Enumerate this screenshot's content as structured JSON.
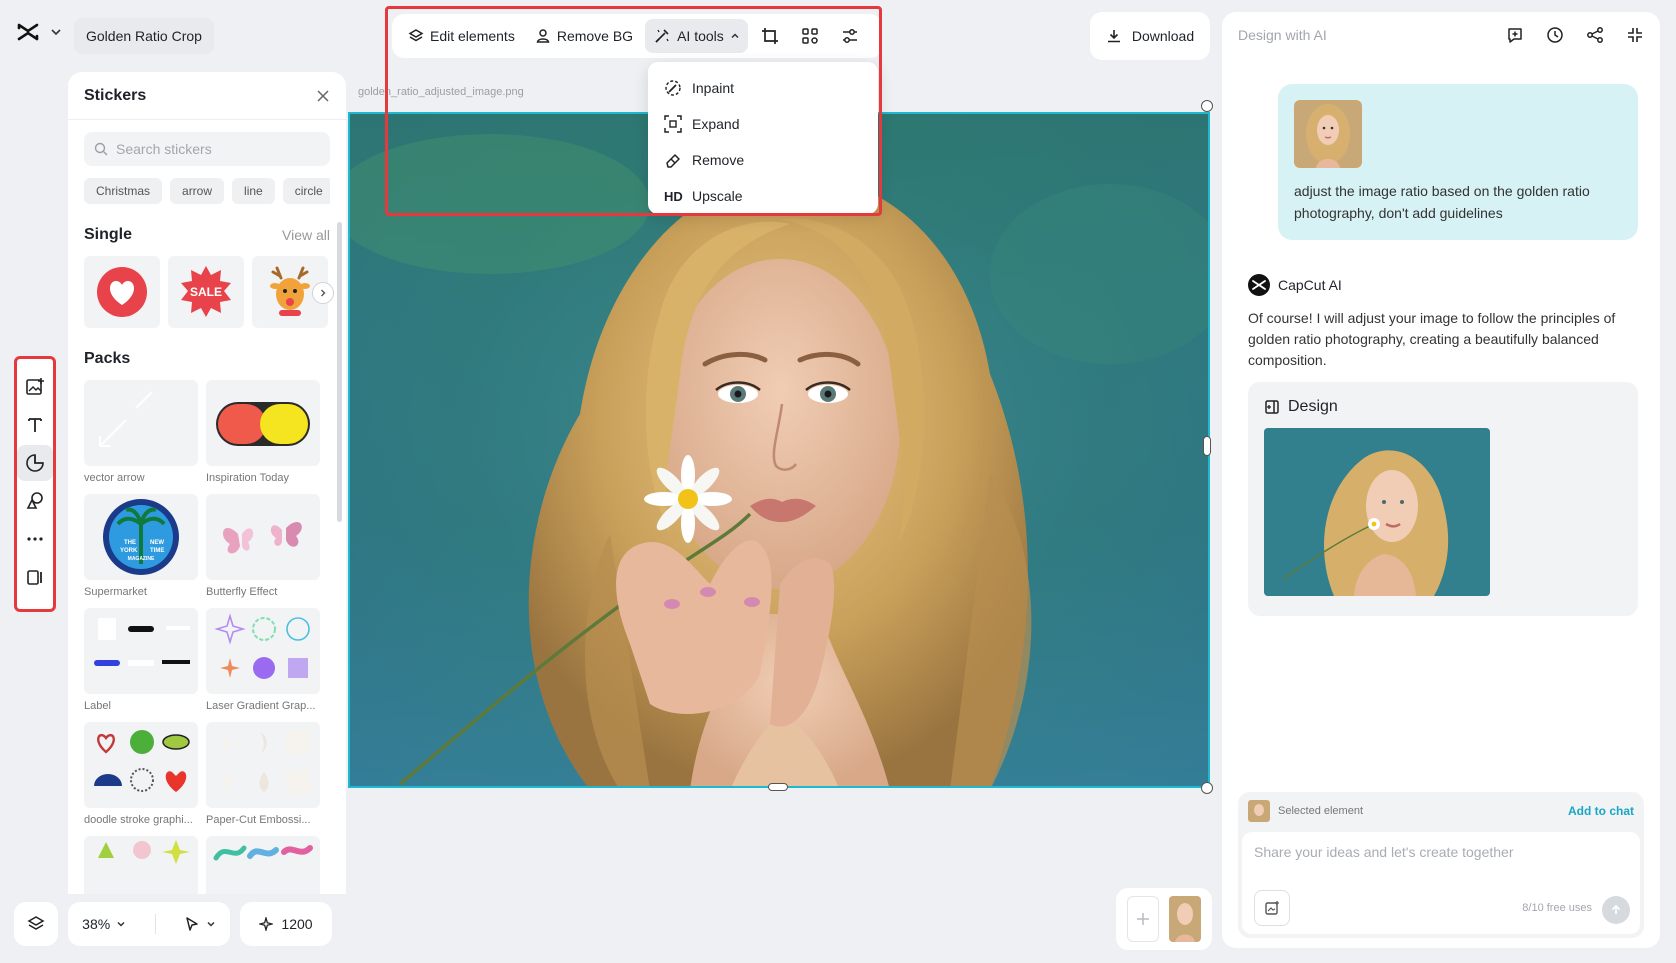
{
  "header": {
    "project_name": "Golden Ratio Crop"
  },
  "toolbar": {
    "edit_elements": "Edit elements",
    "remove_bg": "Remove BG",
    "ai_tools": "AI tools"
  },
  "ai_tools_menu": [
    {
      "icon": "inpaint-icon",
      "label": "Inpaint"
    },
    {
      "icon": "expand-icon",
      "label": "Expand"
    },
    {
      "icon": "eraser-icon",
      "label": "Remove"
    },
    {
      "icon": "hd-icon",
      "label": "Upscale"
    }
  ],
  "download_label": "Download",
  "canvas": {
    "file_name": "golden_ratio_adjusted_image.png"
  },
  "stickers": {
    "title": "Stickers",
    "search_placeholder": "Search stickers",
    "chips": [
      "Christmas",
      "arrow",
      "line",
      "circle"
    ],
    "single_title": "Single",
    "view_all": "View all",
    "packs_title": "Packs",
    "packs": [
      {
        "label": "vector arrow"
      },
      {
        "label": "Inspiration Today"
      },
      {
        "label": "Supermarket"
      },
      {
        "label": "Butterfly Effect"
      },
      {
        "label": "Label"
      },
      {
        "label": "Laser Gradient Grap..."
      },
      {
        "label": "doodle stroke graphi..."
      },
      {
        "label": "Paper-Cut Embossi..."
      }
    ],
    "sale_text": "SALE",
    "magazine_text": [
      "THE",
      "NEW",
      "YORK",
      "TIME",
      "MAGAZINE"
    ]
  },
  "bottom_bar": {
    "zoom": "38%",
    "steps": "1200"
  },
  "ai_panel": {
    "title": "Design with AI",
    "user_message": "adjust the image ratio based on the golden ratio photography, don't add guidelines",
    "bot_name": "CapCut AI",
    "bot_message": "Of course! I will adjust your image to follow the principles of golden ratio photography, creating a beautifully balanced composition.",
    "design_label": "Design",
    "selected_element": "Selected element",
    "add_to_chat": "Add to chat",
    "input_placeholder": "Share your ideas and let's create together",
    "free_uses": "8/10 free uses"
  },
  "colors": {
    "accent": "#1eb8cf",
    "highlight": "#e6393e",
    "link": "#19a7c4"
  }
}
